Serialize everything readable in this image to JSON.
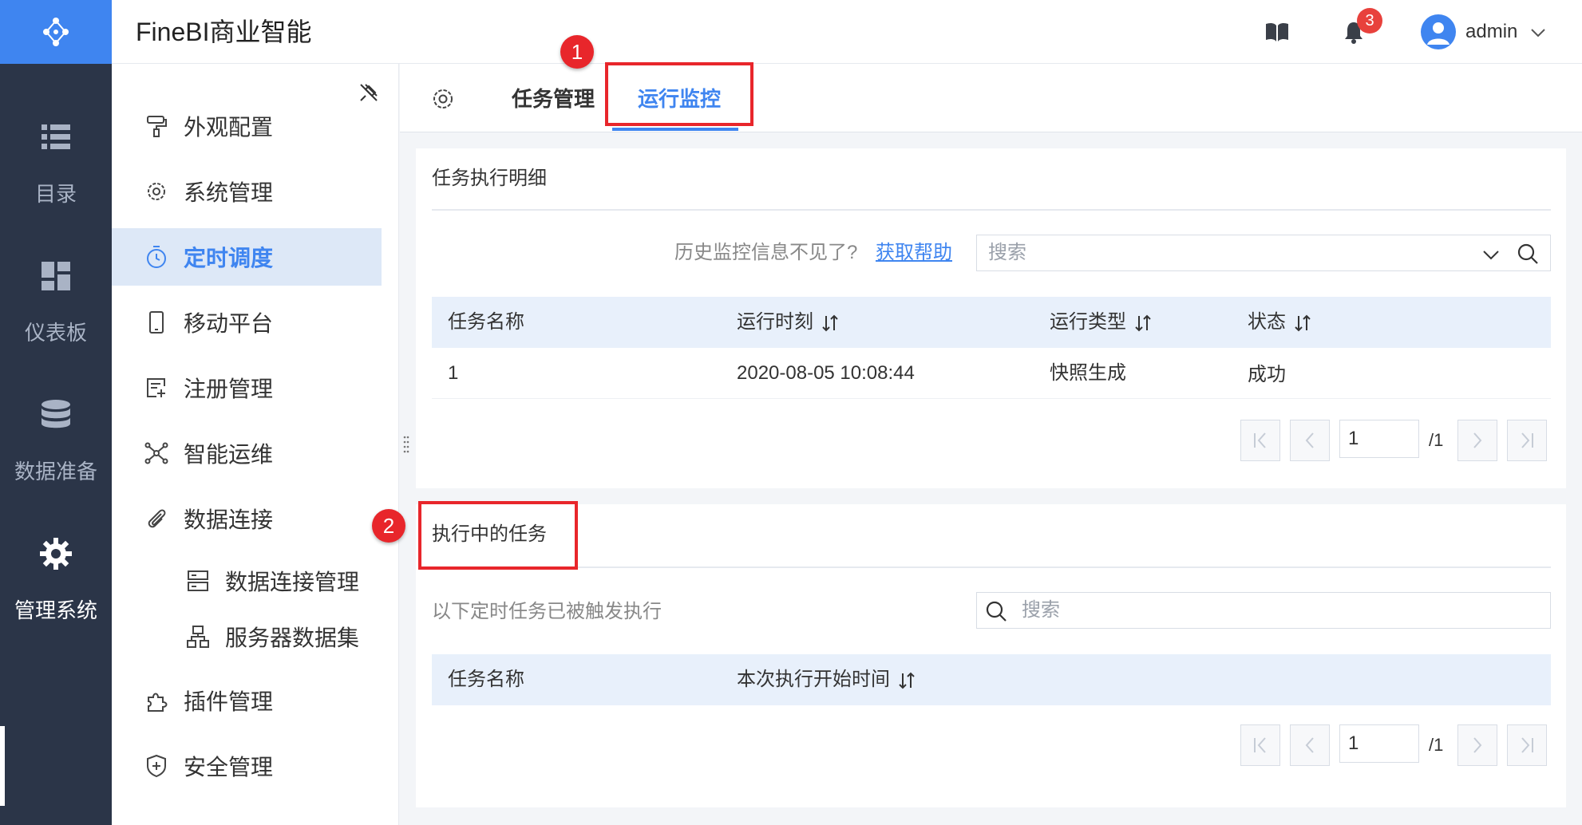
{
  "header": {
    "app_title": "FineBI商业智能",
    "notification_count": "3",
    "user_name": "admin"
  },
  "rail": {
    "items": [
      {
        "label": "目录",
        "icon": "list-icon"
      },
      {
        "label": "仪表板",
        "icon": "dashboard-icon"
      },
      {
        "label": "数据准备",
        "icon": "database-icon"
      },
      {
        "label": "管理系统",
        "icon": "gear-icon",
        "active": true
      }
    ]
  },
  "subnav": {
    "items": [
      {
        "label": "外观配置",
        "icon": "paint-roller-icon"
      },
      {
        "label": "系统管理",
        "icon": "gear-icon"
      },
      {
        "label": "定时调度",
        "icon": "timer-icon",
        "active": true
      },
      {
        "label": "移动平台",
        "icon": "mobile-icon"
      },
      {
        "label": "注册管理",
        "icon": "registration-icon"
      },
      {
        "label": "智能运维",
        "icon": "network-icon"
      },
      {
        "label": "数据连接",
        "icon": "paperclip-icon"
      },
      {
        "label": "数据连接管理",
        "icon": "server-stack-icon",
        "sub": true
      },
      {
        "label": "服务器数据集",
        "icon": "server-tree-icon",
        "sub": true
      },
      {
        "label": "插件管理",
        "icon": "puzzle-icon"
      },
      {
        "label": "安全管理",
        "icon": "shield-icon"
      }
    ]
  },
  "tabs": {
    "items": [
      {
        "label": "任务管理"
      },
      {
        "label": "运行监控",
        "active": true
      }
    ]
  },
  "task_detail": {
    "title": "任务执行明细",
    "hint": "历史监控信息不见了?",
    "help_link": "获取帮助",
    "search_placeholder": "搜索",
    "columns": [
      "任务名称",
      "运行时刻",
      "运行类型",
      "状态"
    ],
    "rows": [
      {
        "name": "1",
        "time": "2020-08-05 10:08:44",
        "type": "快照生成",
        "status": "成功"
      }
    ],
    "pager": {
      "page": "1",
      "total": "/1"
    }
  },
  "running_tasks": {
    "title": "执行中的任务",
    "hint": "以下定时任务已被触发执行",
    "search_placeholder": "搜索",
    "columns": [
      "任务名称",
      "本次执行开始时间"
    ],
    "pager": {
      "page": "1",
      "total": "/1"
    }
  },
  "annotations": [
    "1",
    "2"
  ],
  "colors": {
    "accent": "#3f85f0",
    "rail_bg": "#2b3548",
    "annotation_red": "#e8262b",
    "table_header_bg": "#e8f0fb"
  }
}
